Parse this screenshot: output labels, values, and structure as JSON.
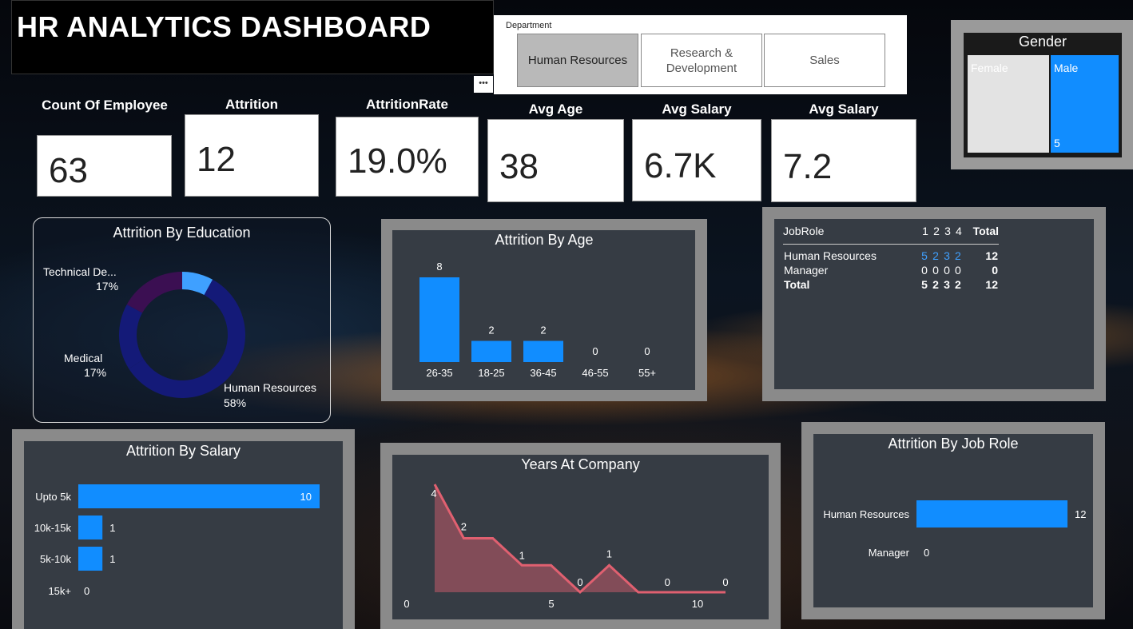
{
  "header": {
    "title": "HR ANALYTICS DASHBOARD",
    "more_label": "•••"
  },
  "slicer": {
    "label": "Department",
    "options": [
      "Human Resources",
      "Research & Development",
      "Sales"
    ],
    "selected": "Human Resources"
  },
  "gender": {
    "title": "Gender",
    "female_label": "Female",
    "male_label": "Male",
    "male_value": "5"
  },
  "kpis": [
    {
      "label": "Count Of Employee",
      "value": "63"
    },
    {
      "label": "Attrition",
      "value": "12"
    },
    {
      "label": "AttritionRate",
      "value": "19.0%"
    },
    {
      "label": "Avg Age",
      "value": "38"
    },
    {
      "label": "Avg Salary",
      "value": "6.7K"
    },
    {
      "label": "Avg Salary",
      "value": "7.2"
    }
  ],
  "colors": {
    "accent": "#118dff",
    "dark_navy": "#141a78",
    "dark_purple": "#3b0f52",
    "light_blue": "#3fa0ff",
    "area_red": "#e06070"
  },
  "chart_data": [
    {
      "type": "pie",
      "title": "Attrition By Education",
      "categories": [
        "Human Resources",
        "Medical",
        "Technical De..."
      ],
      "values": [
        58,
        17,
        17
      ],
      "extra_slices": [
        8
      ],
      "labels": [
        "Human Resources",
        "Medical",
        "Technical De..."
      ],
      "percent_labels": [
        "58%",
        "17%",
        "17%"
      ]
    },
    {
      "type": "bar",
      "title": "Attrition By Age",
      "categories": [
        "26-35",
        "18-25",
        "36-45",
        "46-55",
        "55+"
      ],
      "values": [
        8,
        2,
        2,
        0,
        0
      ]
    },
    {
      "type": "table",
      "columns": [
        "JobRole",
        "1",
        "2",
        "3",
        "4",
        "Total"
      ],
      "rows": [
        [
          "Human Resources",
          "5",
          "2",
          "3",
          "2",
          "12"
        ],
        [
          "Manager",
          "0",
          "0",
          "0",
          "0",
          "0"
        ],
        [
          "Total",
          "5",
          "2",
          "3",
          "2",
          "12"
        ]
      ]
    },
    {
      "type": "bar",
      "title": "Attrition By Salary",
      "orientation": "horizontal",
      "categories": [
        "Upto 5k",
        "10k-15k",
        "5k-10k",
        "15k+"
      ],
      "values": [
        10,
        1,
        1,
        0
      ]
    },
    {
      "type": "area",
      "title": "Years At Company",
      "x": [
        0,
        1,
        2,
        3,
        4,
        5,
        6,
        7,
        8,
        9,
        10
      ],
      "values": [
        4,
        2,
        2,
        1,
        1,
        0,
        1,
        0,
        0,
        0,
        0
      ],
      "point_labels": [
        "4",
        "2",
        "1",
        "0",
        "1",
        "0",
        "0"
      ],
      "xticks": [
        "0",
        "5",
        "10"
      ]
    },
    {
      "type": "bar",
      "title": "Attrition By Job Role",
      "orientation": "horizontal",
      "categories": [
        "Human Resources",
        "Manager"
      ],
      "values": [
        12,
        0
      ]
    }
  ]
}
